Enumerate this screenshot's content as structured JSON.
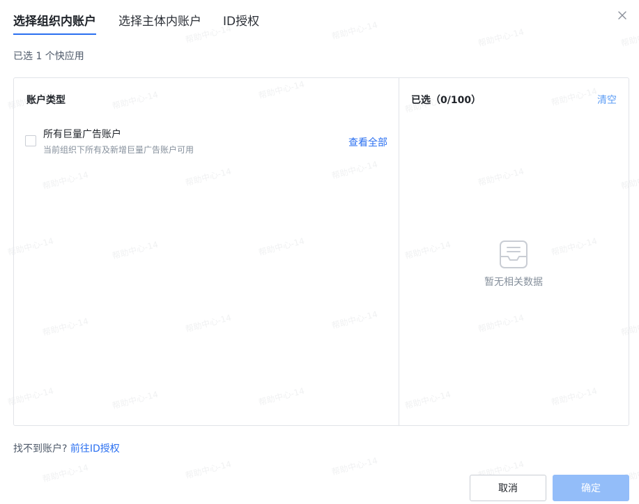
{
  "tabs": [
    {
      "label": "选择组织内账户",
      "active": true
    },
    {
      "label": "选择主体内账户",
      "active": false
    },
    {
      "label": "ID授权",
      "active": false
    }
  ],
  "subtitle": "已选 1 个快应用",
  "left_panel": {
    "header": "账户类型",
    "item": {
      "title": "所有巨量广告账户",
      "description": "当前组织下所有及新增巨量广告账户可用",
      "view_all": "查看全部",
      "checked": false
    }
  },
  "right_panel": {
    "header": "已选（0/100）",
    "clear_label": "清空",
    "empty_text": "暂无相关数据"
  },
  "footer": {
    "note": "找不到账户?",
    "link": "前往ID授权"
  },
  "buttons": {
    "cancel": "取消",
    "confirm": "确定"
  },
  "watermark": "帮助中心-14",
  "icons": {
    "close": "close-icon",
    "empty": "inbox-empty-icon",
    "checkbox": "checkbox-icon"
  },
  "colors": {
    "accent": "#2a6ff0",
    "confirm_disabled": "#93bdf9",
    "clear_link": "#5b9cf5"
  }
}
